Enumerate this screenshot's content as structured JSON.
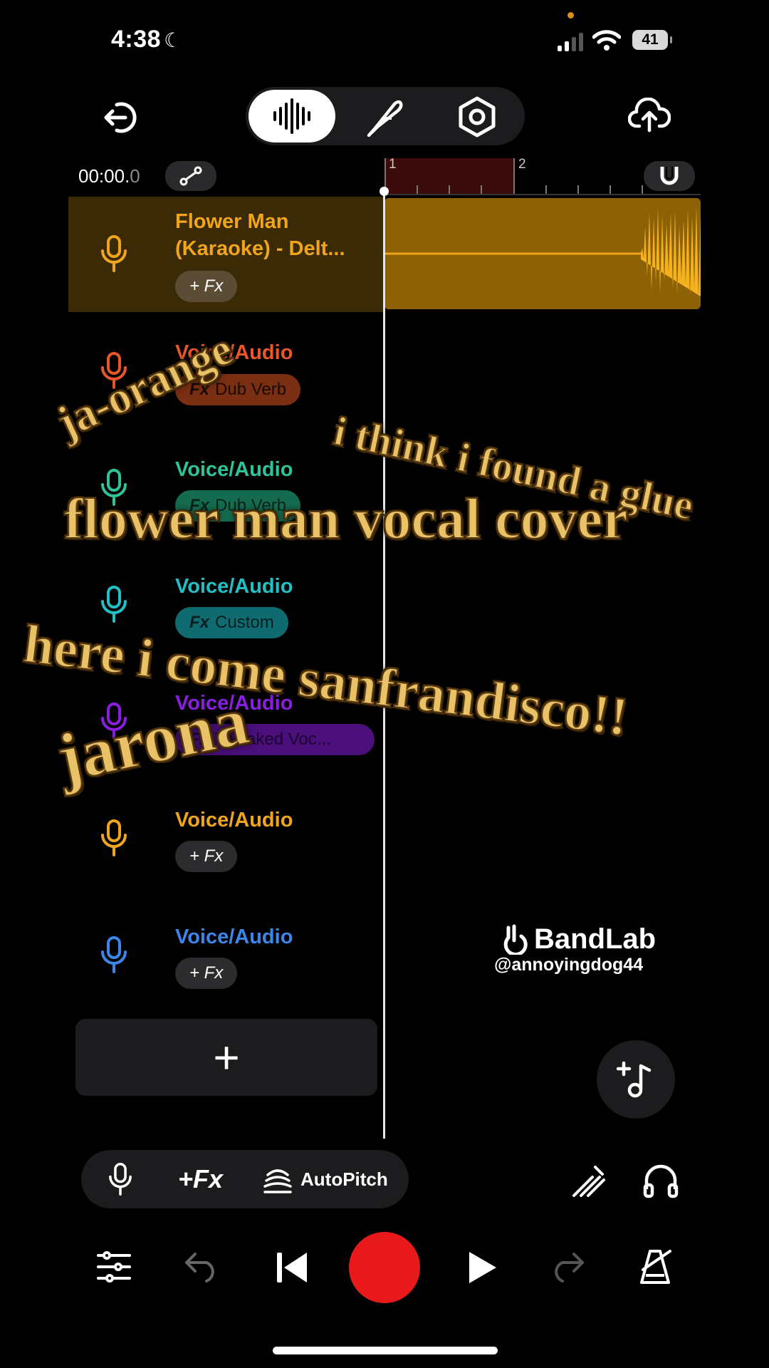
{
  "status_bar": {
    "time": "4:38",
    "battery": "41"
  },
  "toolbar": {
    "back_icon": "exit-icon",
    "tabs": [
      "waveform-icon",
      "feather-icon",
      "settings-hex-icon"
    ],
    "upload_icon": "cloud-upload-icon"
  },
  "timeline": {
    "timecode_main": "00:00.",
    "timecode_frac": "0",
    "bar_1": "1",
    "bar_2": "2"
  },
  "tracks": [
    {
      "name_line1": "Flower Man",
      "name_line2": "(Karaoke) - Delt...",
      "fx": "+ Fx",
      "color": "#f0a51c"
    },
    {
      "name_line1": "Voice/Audio",
      "fx_prefix": "Fx",
      "fx": "Dub Verb",
      "color": "#e8572a",
      "chip_color": "#7a2e12"
    },
    {
      "name_line1": "Voice/Audio",
      "fx_prefix": "Fx",
      "fx": "Dub Verb",
      "color": "#2fc39a",
      "chip_color": "#146b4f"
    },
    {
      "name_line1": "Voice/Audio",
      "fx_prefix": "Fx",
      "fx": "Custom",
      "color": "#22bfc4",
      "chip_color": "#0f6b6f"
    },
    {
      "name_line1": "Voice/Audio",
      "fx_prefix": "Fx",
      "fx": "Tweaked Voc...",
      "color": "#8a1ee0",
      "chip_color": "#4a0f7a"
    },
    {
      "name_line1": "Voice/Audio",
      "fx": "+ Fx",
      "color": "#f0a51c"
    },
    {
      "name_line1": "Voice/Audio",
      "fx": "+ Fx",
      "color": "#3b86e8"
    }
  ],
  "add_track_label": "+",
  "watermark": {
    "brand": "BandLab",
    "handle": "@annoyingdog44"
  },
  "bottom_tools": {
    "fx_label": "+Fx",
    "autopitch_label": "AutoPitch"
  },
  "captions": {
    "c1": "ja-orange",
    "c2": "i think i found a glue",
    "c3": "flower man vocal cover",
    "c4": "here i come sanfrandisco!!",
    "c5": "jarona"
  },
  "colors": {
    "record": "#e8191b",
    "accent_track": "#f0a51c",
    "clip": "#8d6206"
  }
}
